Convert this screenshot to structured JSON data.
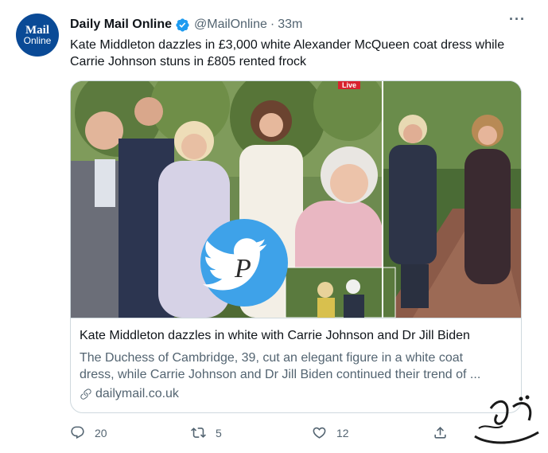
{
  "account": {
    "avatar_line1": "Mail",
    "avatar_line2": "Online",
    "display_name": "Daily Mail Online",
    "handle": "@MailOnline",
    "separator": "·",
    "timestamp": "33m",
    "verified": true
  },
  "tweet": {
    "text": "Kate Middleton dazzles in £3,000 white Alexander McQueen coat dress while Carrie Johnson stuns in £805 rented frock"
  },
  "card": {
    "live_badge": "Live",
    "title": "Kate Middleton dazzles in white with Carrie Johnson and Dr Jill Biden",
    "description_line1": "The Duchess of Cambridge, 39, cut an elegant figure in a white coat",
    "description_line2": "dress, while Carrie Johnson and Dr Jill Biden continued their trend of ...",
    "domain": "dailymail.co.uk"
  },
  "actions": {
    "replies": "20",
    "retweets": "5",
    "likes": "12"
  },
  "colors": {
    "text_primary": "#0f1419",
    "text_secondary": "#536471",
    "verified_blue": "#1d9bf0",
    "brand_blue": "#0a4a96",
    "border": "#cfd9de"
  },
  "icons": [
    "verified-badge-icon",
    "more-icon",
    "link-icon",
    "reply-icon",
    "retweet-icon",
    "like-icon",
    "share-icon",
    "twitter-bird-icon"
  ]
}
